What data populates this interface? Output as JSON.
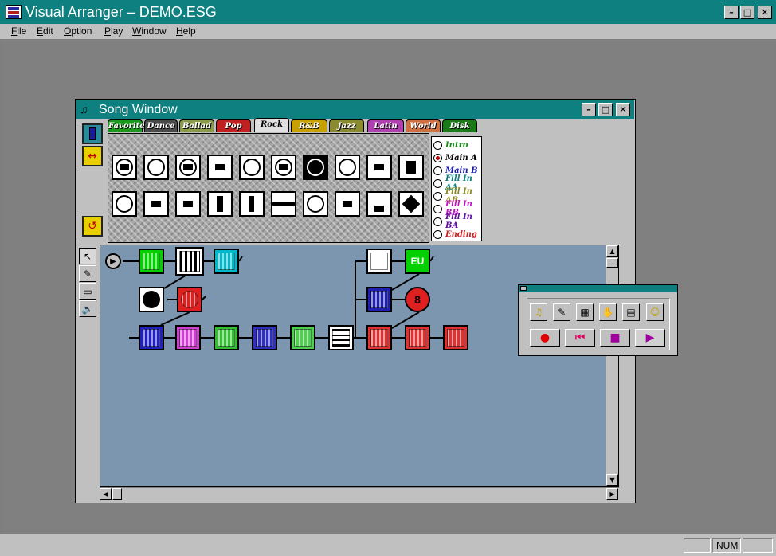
{
  "app": {
    "title": "Visual Arranger – DEMO.ESG",
    "window_controls": {
      "minimize": "–",
      "maximize": "□",
      "close": "✕"
    }
  },
  "menu": {
    "items": [
      "File",
      "Edit",
      "Option",
      "Play",
      "Window",
      "Help"
    ]
  },
  "song_window": {
    "title": "Song Window",
    "controls": {
      "minimize": "–",
      "maximize": "□",
      "close": "✕"
    },
    "tabs": [
      {
        "label": "Favorite",
        "color": "#1a9a1a"
      },
      {
        "label": "Dance",
        "color": "#4a4a4a"
      },
      {
        "label": "Ballad",
        "color": "#8a9a4a"
      },
      {
        "label": "Pop",
        "color": "#c02020"
      },
      {
        "label": "Rock",
        "color": "#ffffff"
      },
      {
        "label": "R&B R&R",
        "color": "#c8a000"
      },
      {
        "label": "Jazz",
        "color": "#8a8a30"
      },
      {
        "label": "Latin",
        "color": "#b040b0"
      },
      {
        "label": "World",
        "color": "#d07040"
      },
      {
        "label": "Disk",
        "color": "#1a7a1a"
      }
    ],
    "active_tab": "Rock",
    "parts": [
      {
        "label": "Intro",
        "color": "#1a8a1a",
        "selected": false
      },
      {
        "label": "Main A",
        "color": "#000000",
        "selected": true
      },
      {
        "label": "Main B",
        "color": "#1a1ab0",
        "selected": false
      },
      {
        "label": "Fill In AA",
        "color": "#108080",
        "selected": false
      },
      {
        "label": "Fill In AB",
        "color": "#8a8a20",
        "selected": false
      },
      {
        "label": "Fill In BB",
        "color": "#c010c0",
        "selected": false
      },
      {
        "label": "Fill In BA",
        "color": "#6010a0",
        "selected": false
      },
      {
        "label": "Ending",
        "color": "#d02020",
        "selected": false
      }
    ],
    "left_tools": [
      "info-icon",
      "split-icon",
      "loop-icon"
    ],
    "edit_tools": [
      "pointer-icon",
      "pencil-icon",
      "eraser-icon",
      "speaker-icon"
    ],
    "style_icons": [
      "skull-guitar",
      "devil-face",
      "monster-face",
      "dragon-face",
      "grin-face",
      "skull-crossbones",
      "fist",
      "shield-face",
      "punk-face",
      "castle",
      "heart-guitar",
      "speakers",
      "house-face",
      "tower",
      "cactus",
      "union-flag",
      "peace-sign",
      "boombox-face",
      "sunset",
      "dice"
    ]
  },
  "arrangement": {
    "play_symbol": "▶",
    "blocks": [
      {
        "color": "#00d000",
        "kind": "keyboard-green"
      },
      {
        "color": "#ffffff",
        "kind": "keyboard-bw"
      },
      {
        "color": "#00b8c8",
        "kind": "keyboard-cyan"
      },
      {
        "color": "#ffffff",
        "kind": "face-bw"
      },
      {
        "color": "#e02020",
        "kind": "face-red"
      },
      {
        "color": "#2020c0",
        "kind": "face-blue"
      },
      {
        "color": "#d040d0",
        "kind": "face-magenta"
      },
      {
        "color": "#30c030",
        "kind": "guitar-green"
      },
      {
        "color": "#3030c0",
        "kind": "guitar-blue"
      },
      {
        "color": "#50d050",
        "kind": "face-green"
      },
      {
        "color": "#ffffff",
        "kind": "totem-bw"
      },
      {
        "color": "#e03030",
        "kind": "boombox-red"
      },
      {
        "color": "#e03030",
        "kind": "boombox-red"
      },
      {
        "color": "#e03030",
        "kind": "boombox-red"
      },
      {
        "color": "#ffffff",
        "kind": "bird-bw"
      },
      {
        "color": "#00d000",
        "kind": "eu-green"
      },
      {
        "color": "#2020b0",
        "kind": "house-blue"
      },
      {
        "color": "#e02020",
        "kind": "eight-ball"
      }
    ],
    "eu_label": "EU",
    "eight_label": "8"
  },
  "transport": {
    "tools": [
      "chord-icon",
      "feather-icon",
      "grid-icon",
      "hand-icon",
      "piano-icon",
      "smiley-icon"
    ],
    "buttons": [
      {
        "name": "record",
        "symbol": "●",
        "color": "#e00000"
      },
      {
        "name": "rewind",
        "symbol": "⏮",
        "color": "#e00060"
      },
      {
        "name": "stop",
        "symbol": "■",
        "color": "#a000a0"
      },
      {
        "name": "play",
        "symbol": "▶",
        "color": "#a000a0"
      }
    ]
  },
  "status": {
    "num": "NUM"
  }
}
